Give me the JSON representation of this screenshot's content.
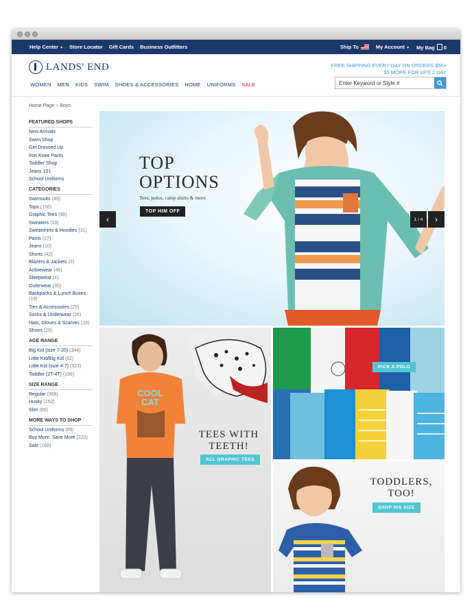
{
  "util_bar": {
    "left_links": [
      "Help Center",
      "Store Locator",
      "Gift Cards",
      "Business Outfitters"
    ],
    "ship_to": "Ship To",
    "my_account": "My Account",
    "my_bag": "My Bag",
    "bag_count": "0"
  },
  "header": {
    "logo_text": "LANDS' END",
    "promo_line1": "FREE SHIPPING EVERY DAY ON ORDERS $50+",
    "promo_line2": "$5 MORE FOR UPS 2 DAY",
    "search_placeholder": "Enter Keyword or Style #",
    "nav": [
      "WOMEN",
      "MEN",
      "KIDS",
      "SWIM",
      "SHOES & ACCESSORIES",
      "HOME",
      "UNIFORMS",
      "SALE"
    ]
  },
  "breadcrumb": {
    "home": "Home Page",
    "sep": "›",
    "current": "Boys"
  },
  "sidebar": {
    "featured_title": "FEATURED SHOPS",
    "featured": [
      "New Arrivals",
      "Swim Shop",
      "Get Dressed Up",
      "Iron Knee Pants",
      "Toddler Shop",
      "Jeans 101",
      "School Uniforms"
    ],
    "categories_title": "CATEGORIES",
    "categories": [
      {
        "label": "Swimsuits",
        "count": "(49)"
      },
      {
        "label": "Tops",
        "count": "(156)"
      },
      {
        "label": "Graphic Tees",
        "count": "(58)"
      },
      {
        "label": "Sweaters",
        "count": "(10)"
      },
      {
        "label": "Sweatshirts & Hoodies",
        "count": "(31)"
      },
      {
        "label": "Pants",
        "count": "(27)"
      },
      {
        "label": "Jeans",
        "count": "(10)"
      },
      {
        "label": "Shorts",
        "count": "(42)"
      },
      {
        "label": "Blazers & Jackets",
        "count": "(3)"
      },
      {
        "label": "Activewear",
        "count": "(46)"
      },
      {
        "label": "Sleepwear",
        "count": "(1)"
      },
      {
        "label": "Outerwear",
        "count": "(30)"
      },
      {
        "label": "Backpacks & Lunch Boxes",
        "count": "(19)"
      },
      {
        "label": "Ties & Accessories",
        "count": "(25)"
      },
      {
        "label": "Socks & Underwear",
        "count": "(26)"
      },
      {
        "label": "Hats, Gloves & Scarves",
        "count": "(18)"
      },
      {
        "label": "Shoes",
        "count": "(29)"
      }
    ],
    "age_title": "AGE RANGE",
    "age": [
      {
        "label": "Big Kid (size 7-20)",
        "count": "(344)"
      },
      {
        "label": "Little Kid/Big Kid",
        "count": "(82)"
      },
      {
        "label": "Little Kid (size 4-7)",
        "count": "(323)"
      },
      {
        "label": "Toddler (2T-4T)",
        "count": "(196)"
      }
    ],
    "size_title": "SIZE RANGE",
    "size": [
      {
        "label": "Regular",
        "count": "(368)"
      },
      {
        "label": "Husky",
        "count": "(152)"
      },
      {
        "label": "Slim",
        "count": "(60)"
      }
    ],
    "more_title": "MORE WAYS TO SHOP",
    "more": [
      {
        "label": "School Uniforms",
        "count": "(55)"
      },
      {
        "label": "Buy More, Save More",
        "count": "(222)"
      },
      {
        "label": "Sale",
        "count": "(166)"
      }
    ]
  },
  "hero": {
    "title1": "TOP",
    "title2": "OPTIONS",
    "subtitle": "Tees, polos, camp shirts & more.",
    "cta": "TOP HIM OFF",
    "pager": "1 / 4"
  },
  "tees": {
    "shirt_text1": "COOL",
    "shirt_text2": "CAT",
    "title1": "TEES WITH",
    "title2": "TEETH!",
    "cta": "ALL GRAPHIC TEES"
  },
  "polo": {
    "cta": "PICK A POLO"
  },
  "toddler": {
    "title1": "TODDLERS,",
    "title2": "TOO!",
    "cta": "SHOP HIS SIZE"
  },
  "colors": {
    "navy": "#1b3968",
    "accent_blue": "#3d9bd6",
    "teal_cta": "#52c6d0",
    "sale_red": "#c8102e"
  }
}
